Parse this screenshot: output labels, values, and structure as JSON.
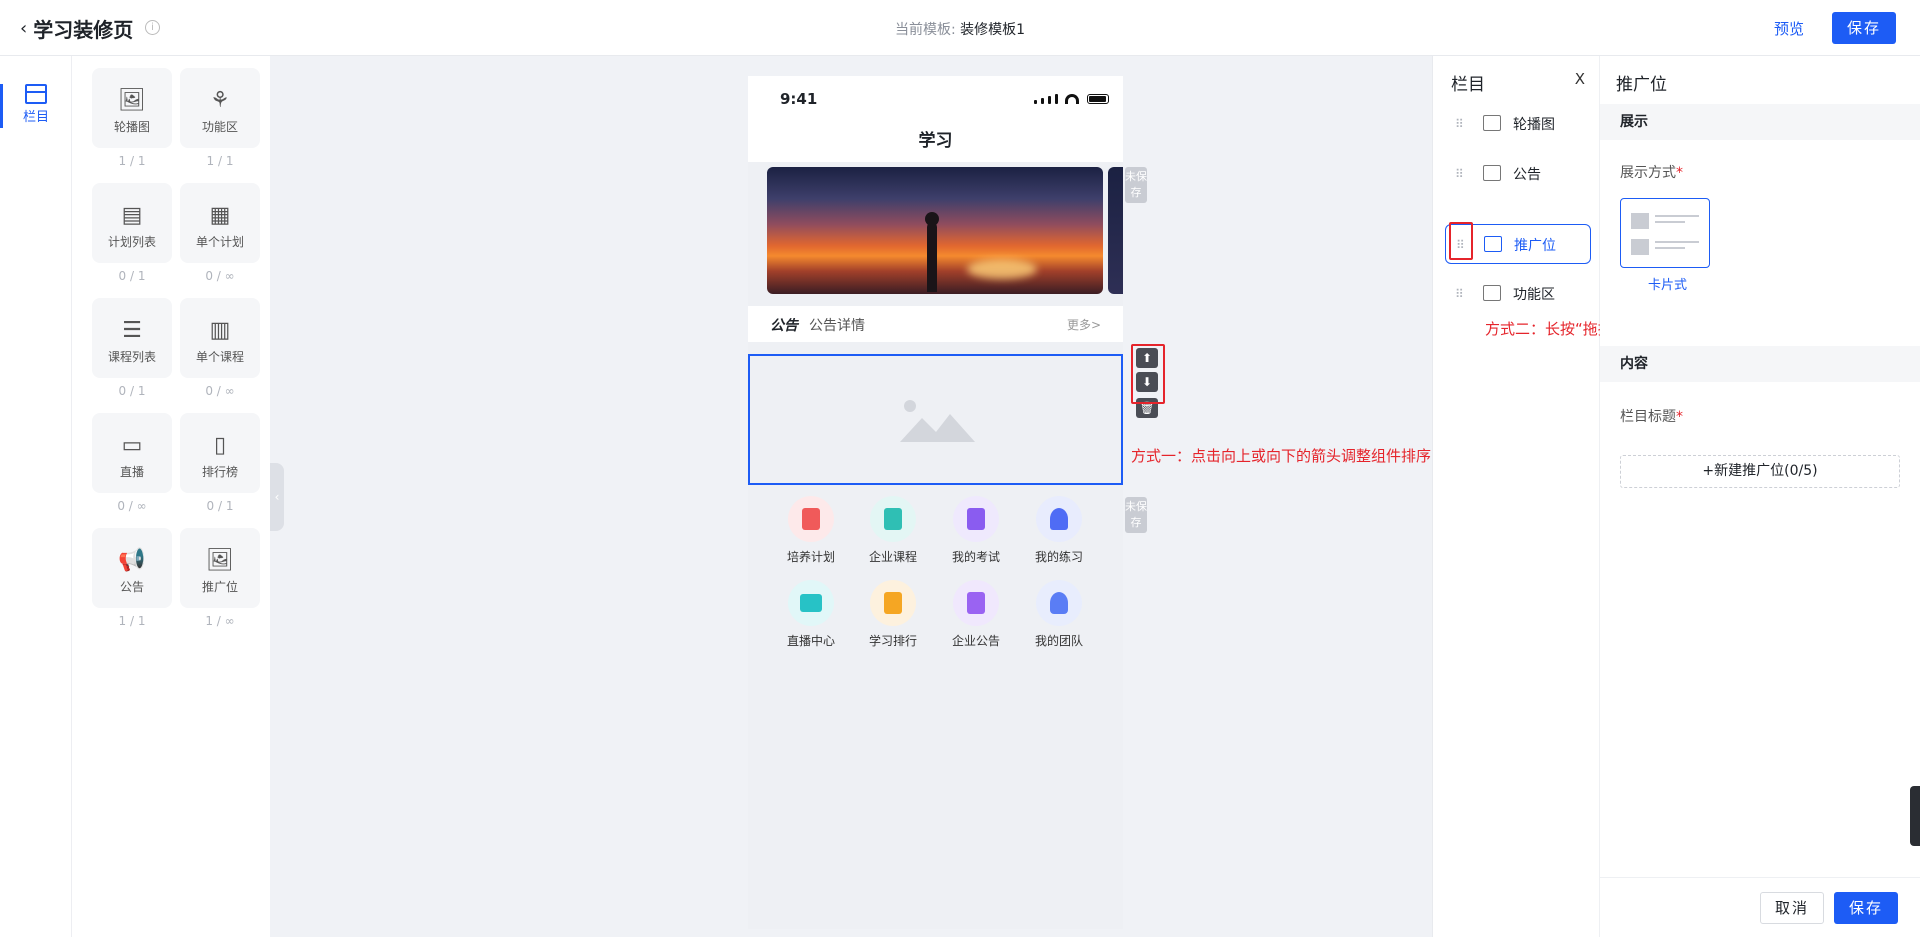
{
  "header": {
    "title": "学习装修页",
    "template_prefix": "当前模板: ",
    "template_name": "装修模板1",
    "preview_label": "预览",
    "save_label": "保存"
  },
  "rail": {
    "item_label": "栏目"
  },
  "library": [
    {
      "label": "轮播图",
      "count": "1 / 1",
      "icon": "image-icon"
    },
    {
      "label": "功能区",
      "count": "1 / 1",
      "icon": "grid-icon"
    },
    {
      "label": "计划列表",
      "count": "0 / 1",
      "icon": "calendar-list-icon"
    },
    {
      "label": "单个计划",
      "count": "0 / ∞",
      "icon": "calendar-icon"
    },
    {
      "label": "课程列表",
      "count": "0 / 1",
      "icon": "stack-icon"
    },
    {
      "label": "单个课程",
      "count": "0 / ∞",
      "icon": "book-icon"
    },
    {
      "label": "直播",
      "count": "0 / ∞",
      "icon": "video-icon"
    },
    {
      "label": "排行榜",
      "count": "0 / 1",
      "icon": "bar-chart-icon"
    },
    {
      "label": "公告",
      "count": "1 / 1",
      "icon": "megaphone-icon"
    },
    {
      "label": "推广位",
      "count": "1 / ∞",
      "icon": "picture-icon"
    }
  ],
  "phone": {
    "time": "9:41",
    "title": "学习",
    "unsaved": "未保存",
    "notice_tag": "公告",
    "notice_text": "公告详情",
    "notice_more": "更多>",
    "grid": [
      {
        "label": "培养计划",
        "color": "#f05a5a",
        "bg": "#fde9ea"
      },
      {
        "label": "企业课程",
        "color": "#2fbfb4",
        "bg": "#e3f6f4"
      },
      {
        "label": "我的考试",
        "color": "#8a5cf0",
        "bg": "#efe9fd"
      },
      {
        "label": "我的练习",
        "color": "#4f6cf5",
        "bg": "#e8ecfd"
      },
      {
        "label": "直播中心",
        "color": "#27c2c6",
        "bg": "#e1f7f8"
      },
      {
        "label": "学习排行",
        "color": "#f5a623",
        "bg": "#fdf1de"
      },
      {
        "label": "企业公告",
        "color": "#9a63f2",
        "bg": "#f0e8fd"
      },
      {
        "label": "我的团队",
        "color": "#5a7df5",
        "bg": "#e8edfd"
      }
    ]
  },
  "annotations": {
    "method1": "方式一：点击向上或向下的箭头调整组件排序",
    "method2": "方式二：长按“拖拽”图标对组件进行拖拽排序"
  },
  "outline": {
    "title": "栏目",
    "close": "X",
    "items": [
      {
        "label": "轮播图",
        "selected": false
      },
      {
        "label": "公告",
        "selected": false
      },
      {
        "label": "推广位",
        "selected": true
      },
      {
        "label": "功能区",
        "selected": false
      }
    ]
  },
  "props": {
    "title": "推广位",
    "section_display": "展示",
    "display_mode_label": "展示方式",
    "display_option": "卡片式",
    "section_content": "内容",
    "column_title_label": "栏目标题",
    "new_button": "+新建推广位(0/5)",
    "cancel_label": "取消",
    "save_label": "保存"
  },
  "colors": {
    "accent": "#1d5cf5",
    "annotation": "#e5242b"
  }
}
